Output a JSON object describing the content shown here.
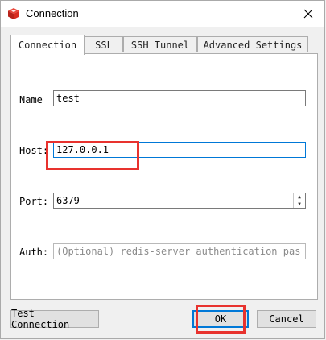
{
  "window": {
    "title": "Connection",
    "app_icon": "redis-cube-icon",
    "close_icon": "close-icon"
  },
  "tabs": [
    {
      "label": "Connection",
      "active": true
    },
    {
      "label": "SSL",
      "active": false
    },
    {
      "label": "SSH Tunnel",
      "active": false
    },
    {
      "label": "Advanced Settings",
      "active": false
    }
  ],
  "form": {
    "name_label": "Name",
    "name_value": "test",
    "host_label": "Host:",
    "host_value": "127.0.0.1",
    "port_label": "Port:",
    "port_value": "6379",
    "auth_label": "Auth:",
    "auth_value": "",
    "auth_placeholder": "(Optional) redis-server authentication pas"
  },
  "buttons": {
    "test_connection": "Test Connection",
    "ok": "OK",
    "cancel": "Cancel"
  },
  "colors": {
    "highlight": "#e8322e",
    "focus": "#0078d7",
    "icon_red": "#d82c20"
  }
}
